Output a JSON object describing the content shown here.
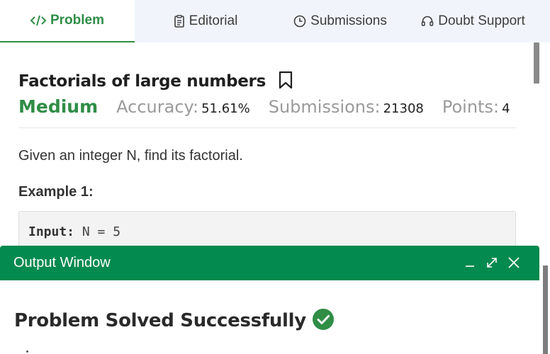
{
  "tabs": [
    {
      "label": "Problem",
      "icon": "code-icon",
      "active": true
    },
    {
      "label": "Editorial",
      "icon": "document-icon",
      "active": false
    },
    {
      "label": "Submissions",
      "icon": "clock-icon",
      "active": false
    },
    {
      "label": "Doubt Support",
      "icon": "headset-icon",
      "active": false
    }
  ],
  "problem": {
    "title": "Factorials of large numbers",
    "difficulty": "Medium",
    "accuracy_label": "Accuracy:",
    "accuracy_value": "51.61%",
    "submissions_label": "Submissions:",
    "submissions_value": "21308",
    "points_label": "Points:",
    "points_value": "4",
    "statement": "Given an integer N, find its factorial.",
    "example_title": "Example 1:",
    "example_input_label": "Input:",
    "example_input_value": "N = 5"
  },
  "output_window": {
    "title": "Output Window",
    "result": "Problem Solved Successfully"
  },
  "colors": {
    "brand_green": "#2f8d46",
    "header_green": "#028a4f",
    "tab_bar_bg": "#f1f5fb"
  }
}
